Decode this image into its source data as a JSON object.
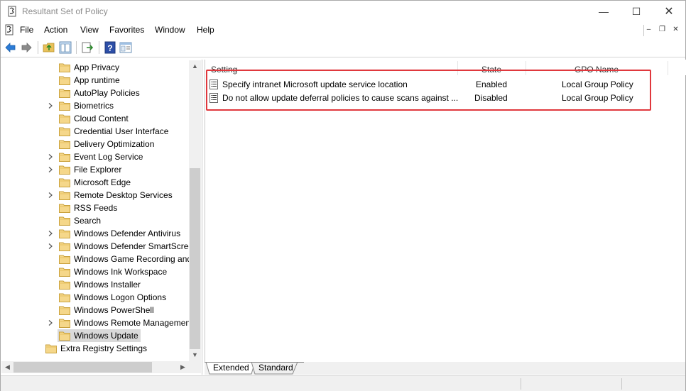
{
  "window": {
    "title": "Resultant Set of Policy",
    "controls": {
      "minimize": "—",
      "maximize": "☐",
      "close": "✕"
    }
  },
  "menu": {
    "items": [
      "File",
      "Action",
      "View",
      "Favorites",
      "Window",
      "Help"
    ]
  },
  "toolbar": {
    "buttons": [
      "back-arrow-icon",
      "forward-arrow-icon",
      "up-folder-icon",
      "show-hide-tree-icon",
      "export-list-icon",
      "help-icon",
      "properties-pane-icon"
    ]
  },
  "tree": {
    "items": [
      {
        "label": "App Privacy",
        "expandable": false
      },
      {
        "label": "App runtime",
        "expandable": false
      },
      {
        "label": "AutoPlay Policies",
        "expandable": false
      },
      {
        "label": "Biometrics",
        "expandable": true
      },
      {
        "label": "Cloud Content",
        "expandable": false
      },
      {
        "label": "Credential User Interface",
        "expandable": false
      },
      {
        "label": "Delivery Optimization",
        "expandable": false
      },
      {
        "label": "Event Log Service",
        "expandable": true
      },
      {
        "label": "File Explorer",
        "expandable": true
      },
      {
        "label": "Microsoft Edge",
        "expandable": false
      },
      {
        "label": "Remote Desktop Services",
        "expandable": true
      },
      {
        "label": "RSS Feeds",
        "expandable": false
      },
      {
        "label": "Search",
        "expandable": false
      },
      {
        "label": "Windows Defender Antivirus",
        "expandable": true
      },
      {
        "label": "Windows Defender SmartScree",
        "expandable": true
      },
      {
        "label": "Windows Game Recording and",
        "expandable": false
      },
      {
        "label": "Windows Ink Workspace",
        "expandable": false
      },
      {
        "label": "Windows Installer",
        "expandable": false
      },
      {
        "label": "Windows Logon Options",
        "expandable": false
      },
      {
        "label": "Windows PowerShell",
        "expandable": false
      },
      {
        "label": "Windows Remote Managemen",
        "expandable": true
      },
      {
        "label": "Windows Update",
        "expandable": false,
        "selected": true
      }
    ],
    "parent_item": "Extra Registry Settings"
  },
  "table": {
    "columns": [
      "Setting",
      "State",
      "GPO Name"
    ],
    "rows": [
      {
        "setting": "Specify intranet Microsoft update service location",
        "state": "Enabled",
        "gpo": "Local Group Policy"
      },
      {
        "setting": "Do not allow update deferral policies to cause scans against ...",
        "state": "Disabled",
        "gpo": "Local Group Policy"
      }
    ]
  },
  "tabs": [
    "Extended",
    "Standard"
  ],
  "active_tab": "Standard",
  "colors": {
    "highlight_border": "#e0383d",
    "selection_bg": "#d9d9d9",
    "folder": "#f5d78a"
  }
}
